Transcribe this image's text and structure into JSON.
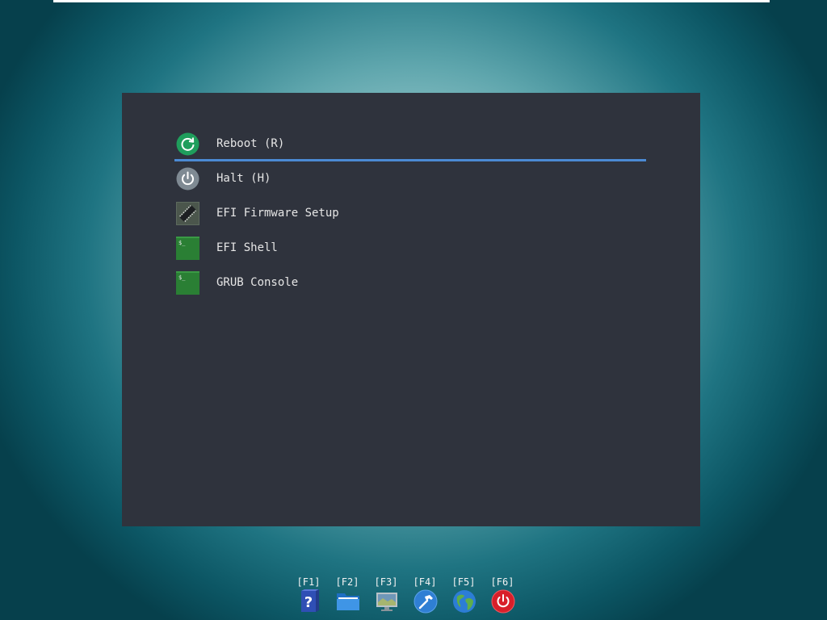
{
  "menu": {
    "items": [
      {
        "label": "Reboot (R)",
        "icon": "reboot-icon"
      },
      {
        "label": "Halt (H)",
        "icon": "power-icon"
      },
      {
        "label": "EFI Firmware Setup",
        "icon": "chip-icon"
      },
      {
        "label": "EFI Shell",
        "icon": "terminal-icon"
      },
      {
        "label": "GRUB Console",
        "icon": "terminal-icon"
      }
    ],
    "selected_index": 0
  },
  "hotkeys": [
    {
      "label": "[F1]",
      "icon": "help-icon"
    },
    {
      "label": "[F2]",
      "icon": "folder-icon"
    },
    {
      "label": "[F3]",
      "icon": "display-icon"
    },
    {
      "label": "[F4]",
      "icon": "hammer-icon"
    },
    {
      "label": "[F5]",
      "icon": "globe-icon"
    },
    {
      "label": "[F6]",
      "icon": "power-icon"
    }
  ],
  "colors": {
    "panel": "#2f333d",
    "selection": "#4b8ad4",
    "reboot": "#1f9e5c",
    "halt": "#7f8a93",
    "terminal": "#2f8a3a",
    "power_red": "#d81f2a"
  }
}
